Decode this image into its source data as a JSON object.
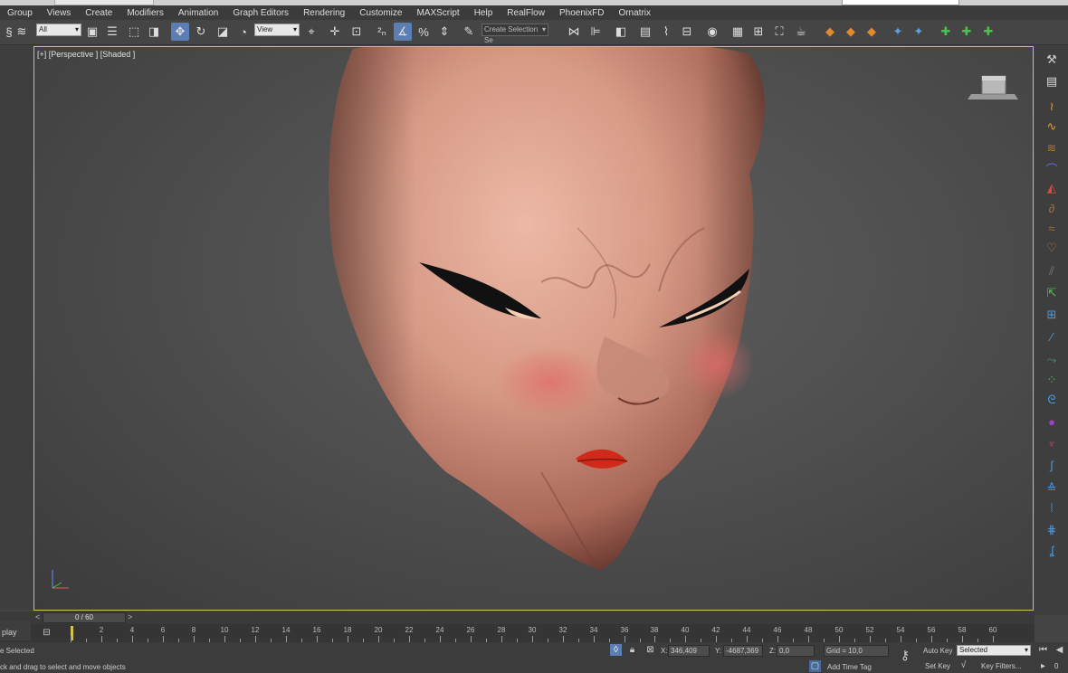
{
  "menu": [
    "Group",
    "Views",
    "Create",
    "Modifiers",
    "Animation",
    "Graph Editors",
    "Rendering",
    "Customize",
    "MAXScript",
    "Help",
    "RealFlow",
    "PhoenixFD",
    "Ornatrix"
  ],
  "toolbar": {
    "filter_value": "All",
    "ref_coord_value": "View",
    "selection_set_placeholder": "Create Selection Se"
  },
  "viewport": {
    "label": "[+] [Perspective ] [Shaded ]"
  },
  "timeslider": {
    "frame_counter": "0 / 60",
    "prev_arrow": "<",
    "next_arrow": ">"
  },
  "trackbar": {
    "play_label": "play",
    "ticks": [
      "0",
      "2",
      "4",
      "6",
      "8",
      "10",
      "12",
      "14",
      "16",
      "18",
      "20",
      "22",
      "24",
      "26",
      "28",
      "30",
      "32",
      "34",
      "36",
      "38",
      "40",
      "42",
      "44",
      "46",
      "48",
      "50",
      "52",
      "54",
      "56",
      "58",
      "60"
    ]
  },
  "status": {
    "selection_info": "e Selected",
    "prompt": "ck and drag to select and move objects",
    "x_label": "X:",
    "x_value": "346,409",
    "y_label": "Y:",
    "y_value": "-4687,369",
    "z_label": "Z:",
    "z_value": "0,0",
    "grid": "Grid = 10,0",
    "add_time_tag": "Add Time Tag",
    "auto_key": "Auto Key",
    "set_key": "Set Key",
    "selected_value": "Selected",
    "key_filters": "Key Filters...",
    "frame_value": "0"
  },
  "colors": {
    "viewport_border": "#d6c44a",
    "active_tool": "#5b7fb5",
    "ui_dark": "#3c3c3c"
  }
}
